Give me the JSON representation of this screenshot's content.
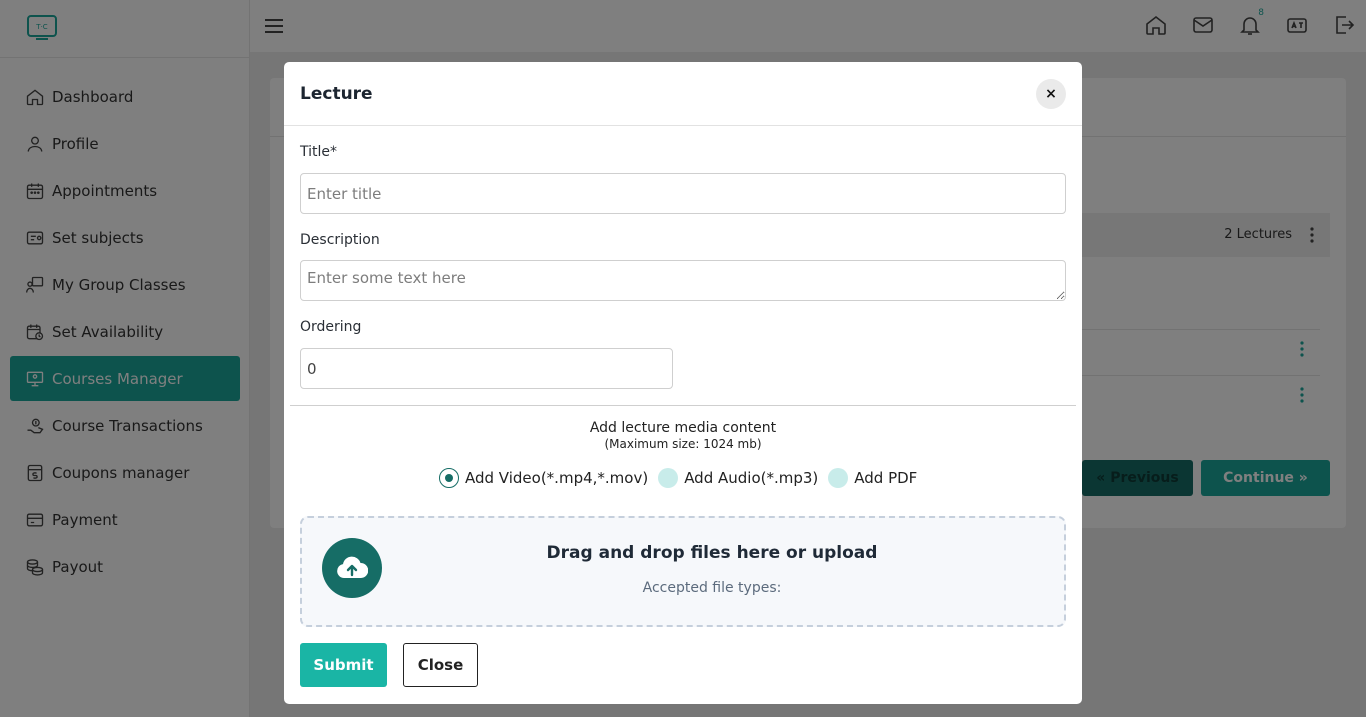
{
  "sidebar": {
    "items": [
      {
        "label": "Dashboard",
        "icon": "home-icon"
      },
      {
        "label": "Profile",
        "icon": "user-icon"
      },
      {
        "label": "Appointments",
        "icon": "calendar-icon"
      },
      {
        "label": "Set subjects",
        "icon": "subjects-icon"
      },
      {
        "label": "My Group Classes",
        "icon": "group-classes-icon"
      },
      {
        "label": "Set Availability",
        "icon": "availability-icon"
      },
      {
        "label": "Courses Manager",
        "icon": "courses-icon",
        "active": true
      },
      {
        "label": "Course Transactions",
        "icon": "transactions-icon"
      },
      {
        "label": "Coupons manager",
        "icon": "coupon-icon"
      },
      {
        "label": "Payment",
        "icon": "card-icon"
      },
      {
        "label": "Payout",
        "icon": "coins-icon"
      }
    ]
  },
  "topbar": {
    "notification_count": "8"
  },
  "background": {
    "lectures_count": "2 Lectures",
    "previous_label": "« Previous",
    "continue_label": "Continue »"
  },
  "modal": {
    "title": "Lecture",
    "close_symbol": "×",
    "title_label": "Title*",
    "title_placeholder": "Enter title",
    "description_label": "Description",
    "description_placeholder": "Enter some text here",
    "ordering_label": "Ordering",
    "ordering_value": "0",
    "media_heading": "Add lecture media content",
    "media_subheading": "(Maximum size: 1024 mb)",
    "media_options": [
      {
        "label": "Add Video(*.mp4,*.mov)",
        "selected": true
      },
      {
        "label": "Add Audio(*.mp3)",
        "selected": false
      },
      {
        "label": "Add PDF",
        "selected": false
      }
    ],
    "dropzone_title": "Drag and drop files here or upload",
    "dropzone_subtitle": "Accepted file types:",
    "submit_label": "Submit",
    "close_label": "Close"
  },
  "colors": {
    "accent": "#1aa79b",
    "accent_dark": "#166d66",
    "submit": "#1ab5a5"
  }
}
